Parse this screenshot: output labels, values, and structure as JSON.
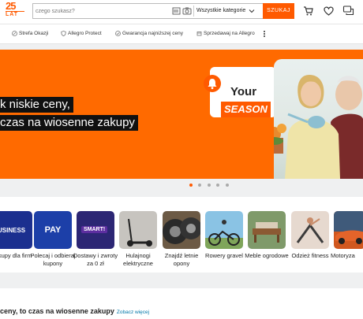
{
  "header": {
    "logo_line1": "25",
    "logo_line2": "LAT",
    "search_placeholder": "czego szukasz?",
    "category_selected": "Wszystkie kategorie",
    "search_button": "SZUKAJ",
    "icons": [
      "cart-icon",
      "heart-icon",
      "chat-icon"
    ],
    "accent": "#ff5a00"
  },
  "subnav": {
    "items": [
      "Strefa Okazji",
      "Allegro Protect",
      "Gwarancja najniższej ceny",
      "Sprzedawaj na Allegro"
    ]
  },
  "banner": {
    "headline_line1": "k niskie ceny,",
    "headline_line2": "czas na wiosenne zakupy",
    "badge_word1": "Your",
    "badge_word2": "SEASON",
    "dots_total": 5,
    "dots_active": 1,
    "bg_color": "#ff6a00"
  },
  "categories": [
    {
      "tile": "USINESS",
      "label": "akupy dla firm",
      "color": "#1b2f8f"
    },
    {
      "tile": "PAY",
      "label": "Polecaj i odbieraj kupony",
      "color": "#1c3fa8"
    },
    {
      "tile": "SMART!",
      "label": "Dostawy i zwroty za 0 zł",
      "color": "#2c2674"
    },
    {
      "tile": "",
      "label": "Hulajnogi elektryczne",
      "color": "#c7c4bf"
    },
    {
      "tile": "",
      "label": "Znajdź letnie opony",
      "color": "#6c5a45"
    },
    {
      "tile": "",
      "label": "Rowery gravel",
      "color": "#8ac3e4"
    },
    {
      "tile": "",
      "label": "Meble ogrodowe",
      "color": "#7f9a6a"
    },
    {
      "tile": "",
      "label": "Odzież fitness",
      "color": "#e6d9cf"
    },
    {
      "tile": "",
      "label": "Motoryza",
      "color": "#d1581f"
    }
  ],
  "section": {
    "title": "ceny, to czas na wiosenne zakupy",
    "link": "Zobacz więcej"
  }
}
